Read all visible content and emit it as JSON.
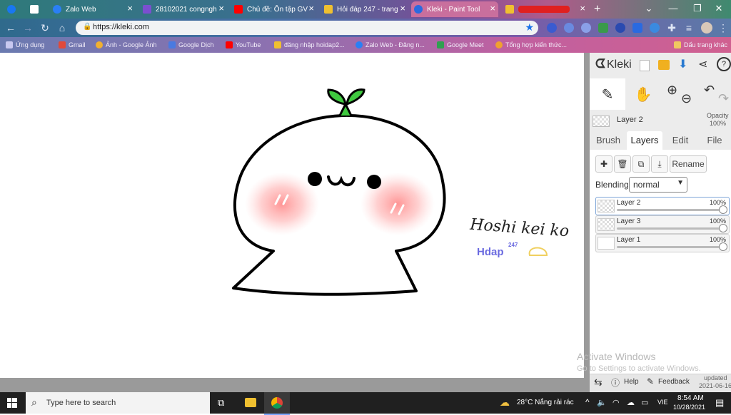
{
  "browser": {
    "tabs": [
      {
        "label": "",
        "icon": "facebook-icon"
      },
      {
        "label": "",
        "icon": "window-icon"
      },
      {
        "label": "Zalo Web",
        "icon": "zalo-icon"
      },
      {
        "label": "28102021 congngh",
        "icon": "doc-icon"
      },
      {
        "label": "Chủ đề: Ôn tập GV",
        "icon": "youtube-icon"
      },
      {
        "label": "Hỏi đáp 247 - trang",
        "icon": "hoidap-icon"
      },
      {
        "label": "Kleki - Paint Tool",
        "icon": "kleki-icon"
      },
      {
        "label": "",
        "icon": "hoidap-icon"
      }
    ],
    "new_tab": "+",
    "url": "https://kleki.com",
    "bookmarks": [
      "Ứng dụng",
      "Gmail",
      "Ảnh - Google Ảnh",
      "Google Dịch",
      "YouTube",
      "đăng nhập hoidap2...",
      "Zalo Web - Đăng n...",
      "Google Meet",
      "Tổng hợp kiến thức...",
      "Dấu trang khác"
    ]
  },
  "drawing": {
    "signature": "Hoshi kei ko",
    "watermark": "Hdap",
    "watermark_sup": "247"
  },
  "kleki": {
    "logo": "Kleki",
    "current_layer": "Layer 2",
    "opacity_label": "Opacity",
    "opacity_value": "100%",
    "tabs": [
      "Brush",
      "Layers",
      "Edit",
      "File"
    ],
    "active_tab": "Layers",
    "rename_label": "Rename",
    "blending_label": "Blending",
    "blending_value": "normal",
    "layers": [
      {
        "name": "Layer 2",
        "opacity": "100%",
        "active": true
      },
      {
        "name": "Layer 3",
        "opacity": "100%",
        "active": false
      },
      {
        "name": "Layer 1",
        "opacity": "100%",
        "active": false
      }
    ],
    "help_label": "Help",
    "feedback_label": "Feedback",
    "updated_label": "updated",
    "updated_date": "2021-06-16"
  },
  "activate": {
    "title": "Activate Windows",
    "subtitle": "Go to Settings to activate Windows."
  },
  "taskbar": {
    "search_placeholder": "Type here to search",
    "weather": "28°C  Nắng rải rác",
    "lang": "VIE",
    "time": "8:54 AM",
    "date": "10/28/2021"
  },
  "colors": {
    "outline": "#000000",
    "sprout": "#3fc93f",
    "blush": "#ff9a9a",
    "kleki_panel": "#ececec",
    "taskbar": "#202020"
  }
}
